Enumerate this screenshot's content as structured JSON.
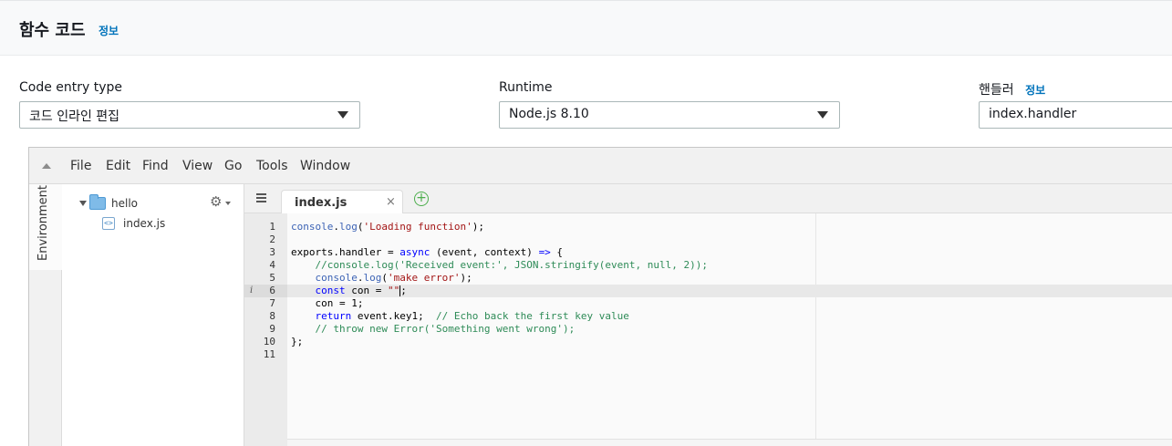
{
  "header": {
    "title": "함수 코드",
    "info": "정보"
  },
  "fields": {
    "code_entry_type": {
      "label": "Code entry type",
      "value": "코드 인라인 편집"
    },
    "runtime": {
      "label": "Runtime",
      "value": "Node.js 8.10"
    },
    "handler": {
      "label": "핸들러",
      "info": "정보",
      "value": "index.handler"
    }
  },
  "ide": {
    "menu": [
      "File",
      "Edit",
      "Find",
      "View",
      "Go",
      "Tools",
      "Window"
    ],
    "side_tab": "Environment",
    "tree": {
      "folder": "hello",
      "file": "index.js",
      "file_icon_glyph": "<>"
    },
    "tab": {
      "label": "index.js",
      "close": "×",
      "add": "+"
    },
    "active_line": 6,
    "line_numbers": [
      "1",
      "2",
      "3",
      "4",
      "5",
      "6",
      "7",
      "8",
      "9",
      "10",
      "11"
    ],
    "code_lines": [
      [
        [
          "fn",
          "console"
        ],
        [
          "pl",
          "."
        ],
        [
          "fn",
          "log"
        ],
        [
          "pl",
          "("
        ],
        [
          "str",
          "'Loading function'"
        ],
        [
          "pl",
          ");"
        ]
      ],
      [],
      [
        [
          "pl",
          "exports.handler = "
        ],
        [
          "kw",
          "async"
        ],
        [
          "pl",
          " (event, context) "
        ],
        [
          "kw",
          "=>"
        ],
        [
          "pl",
          " {"
        ]
      ],
      [
        [
          "pl",
          "    "
        ],
        [
          "cm",
          "//console.log('Received event:', JSON.stringify(event, null, 2));"
        ]
      ],
      [
        [
          "pl",
          "    "
        ],
        [
          "fn",
          "console"
        ],
        [
          "pl",
          "."
        ],
        [
          "fn",
          "log"
        ],
        [
          "pl",
          "("
        ],
        [
          "str",
          "'make error'"
        ],
        [
          "pl",
          ");"
        ]
      ],
      [
        [
          "pl",
          "    "
        ],
        [
          "kw",
          "const"
        ],
        [
          "pl",
          " con = "
        ],
        [
          "str",
          "\"\""
        ],
        [
          "pl",
          ";"
        ]
      ],
      [
        [
          "pl",
          "    con = 1;"
        ]
      ],
      [
        [
          "pl",
          "    "
        ],
        [
          "kw",
          "return"
        ],
        [
          "pl",
          " event.key1;  "
        ],
        [
          "cm",
          "// Echo back the first key value"
        ]
      ],
      [
        [
          "pl",
          "    "
        ],
        [
          "cm",
          "// throw new Error('Something went wrong');"
        ]
      ],
      [
        [
          "pl",
          "};"
        ]
      ],
      []
    ]
  }
}
